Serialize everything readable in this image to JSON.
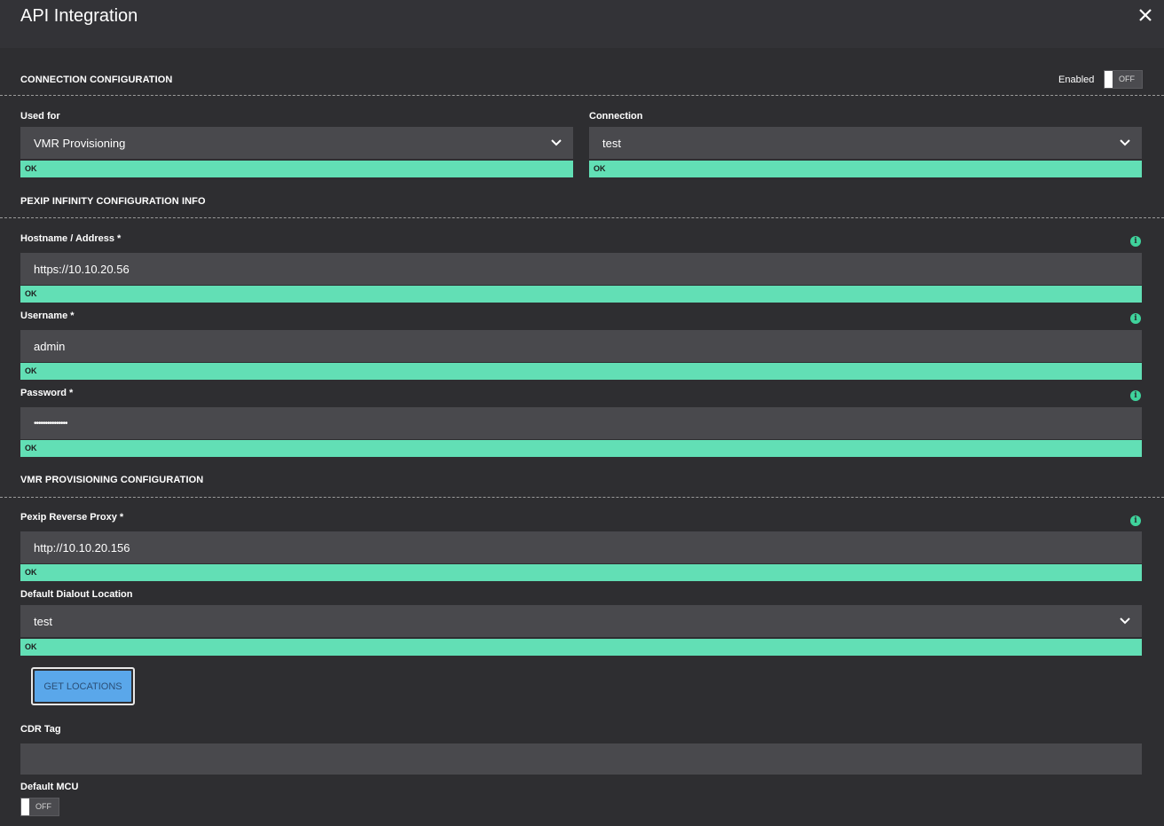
{
  "header": {
    "title": "API Integration"
  },
  "connection": {
    "section_title": "CONNECTION CONFIGURATION",
    "enabled_label": "Enabled",
    "enabled_toggle": "OFF",
    "used_for": {
      "label": "Used for",
      "value": "VMR Provisioning",
      "status": "OK"
    },
    "connection": {
      "label": "Connection",
      "value": "test",
      "status": "OK"
    }
  },
  "pexip": {
    "section_title": "PEXIP INFINITY CONFIGURATION INFO",
    "hostname": {
      "label": "Hostname / Address *",
      "value": "https://10.10.20.56",
      "status": "OK"
    },
    "username": {
      "label": "Username *",
      "value": "admin",
      "status": "OK"
    },
    "password": {
      "label": "Password *",
      "value": "•••••••••••••••",
      "status": "OK"
    }
  },
  "vmr": {
    "section_title": "VMR PROVISIONING CONFIGURATION",
    "reverse_proxy": {
      "label": "Pexip Reverse Proxy *",
      "value": "http://10.10.20.156",
      "status": "OK"
    },
    "dialout": {
      "label": "Default Dialout Location",
      "value": "test",
      "status": "OK"
    },
    "get_locations_label": "GET LOCATIONS",
    "cdr_tag": {
      "label": "CDR Tag",
      "value": ""
    },
    "default_mcu": {
      "label": "Default MCU",
      "toggle": "OFF"
    }
  },
  "icons": {
    "info": "info-icon",
    "close": "close-icon",
    "chevron": "chevron-down-icon"
  },
  "colors": {
    "accent_ok": "#62dfb5",
    "info": "#3fd39c",
    "button": "#5aa7ea",
    "background": "#2e2e31",
    "field": "#49494d"
  }
}
